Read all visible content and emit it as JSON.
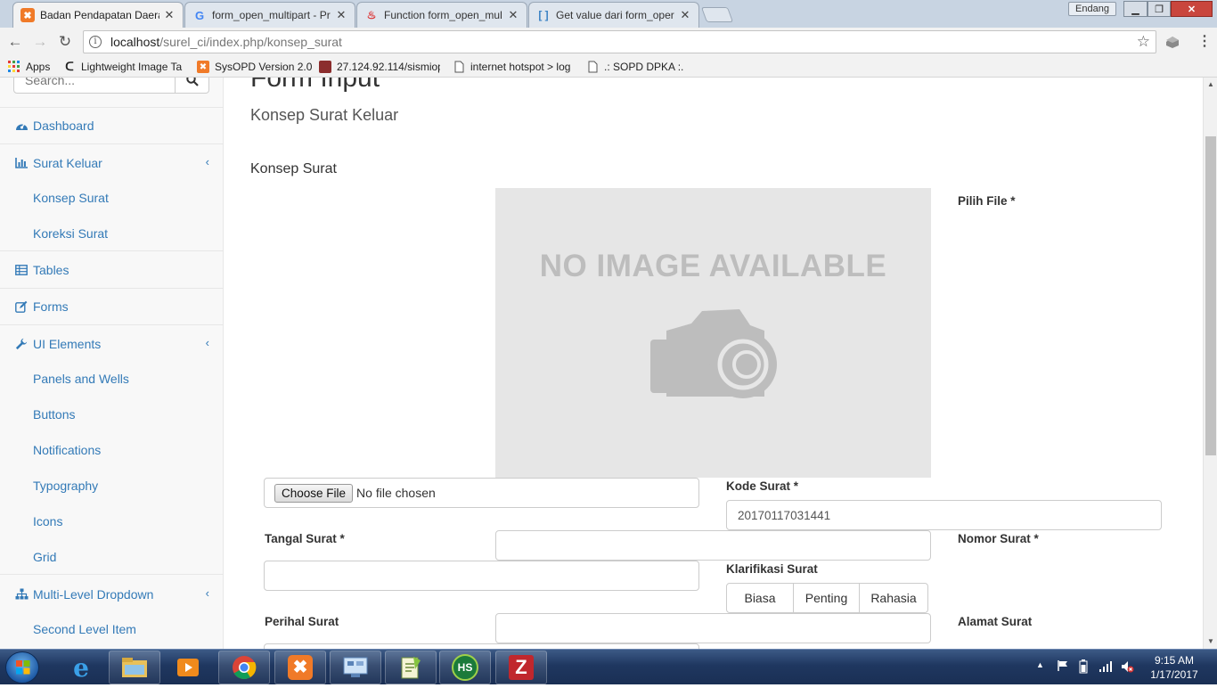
{
  "browser": {
    "tabs": [
      {
        "title": "Badan Pendapatan Daera",
        "active": true,
        "favicon": "xampp-icon"
      },
      {
        "title": "form_open_multipart - Pr",
        "active": false,
        "favicon": "google-icon"
      },
      {
        "title": "Function form_open_mul",
        "active": false,
        "favicon": "codeigniter-icon"
      },
      {
        "title": "Get value dari form_oper",
        "active": false,
        "favicon": "brackets-icon"
      }
    ],
    "user_name": "Endang",
    "url_host": "localhost",
    "url_path": "/surel_ci/index.php/konsep_surat",
    "bookmarks": [
      {
        "label": "Apps",
        "icon": "apps-grid-icon"
      },
      {
        "label": "Lightweight Image Ta",
        "icon": "bookmark-c-icon"
      },
      {
        "label": "SysOPD Version 2.0",
        "icon": "xampp-icon"
      },
      {
        "label": "27.124.92.114/sismiop",
        "icon": "site-icon"
      },
      {
        "label": "internet hotspot > log",
        "icon": "page-icon"
      },
      {
        "label": ".: SOPD DPKA :.",
        "icon": "page-icon"
      }
    ]
  },
  "sidebar": {
    "search_placeholder": "Search...",
    "items": [
      {
        "label": "Dashboard",
        "icon": "dashboard-icon",
        "has_arrow": false
      },
      {
        "label": "Surat Keluar",
        "icon": "bar-chart-icon",
        "has_arrow": true,
        "children": [
          "Konsep Surat",
          "Koreksi Surat"
        ]
      },
      {
        "label": "Tables",
        "icon": "table-icon",
        "has_arrow": false
      },
      {
        "label": "Forms",
        "icon": "edit-icon",
        "has_arrow": false
      },
      {
        "label": "UI Elements",
        "icon": "wrench-icon",
        "has_arrow": true,
        "children": [
          "Panels and Wells",
          "Buttons",
          "Notifications",
          "Typography",
          "Icons",
          "Grid"
        ]
      },
      {
        "label": "Multi-Level Dropdown",
        "icon": "sitemap-icon",
        "has_arrow": true,
        "children": [
          "Second Level Item"
        ]
      }
    ]
  },
  "main": {
    "page_title": "Form Input",
    "page_subtitle": "Konsep Surat Keluar",
    "section_title": "Konsep Surat",
    "image_placeholder_text": "NO IMAGE AVAILABLE",
    "form": {
      "pilih_file_label": "Pilih File",
      "file_button_label": "Choose File",
      "file_status": "No file chosen",
      "kode_surat_label": "Kode Surat",
      "kode_surat_value": "20170117031441",
      "tangal_surat_label": "Tangal Surat",
      "nomor_surat_label": "Nomor Surat",
      "klarifikasi_label": "Klarifikasi Surat",
      "klarifikasi_options": [
        "Biasa",
        "Penting",
        "Rahasia"
      ],
      "perihal_label": "Perihal Surat",
      "alamat_label": "Alamat Surat",
      "required_mark": "*"
    }
  },
  "taskbar": {
    "time": "9:15 AM",
    "date": "1/17/2017"
  },
  "colors": {
    "link": "#337ab7",
    "sidebar_bg": "#f8f8f8",
    "taskbar": "#1f3760"
  }
}
